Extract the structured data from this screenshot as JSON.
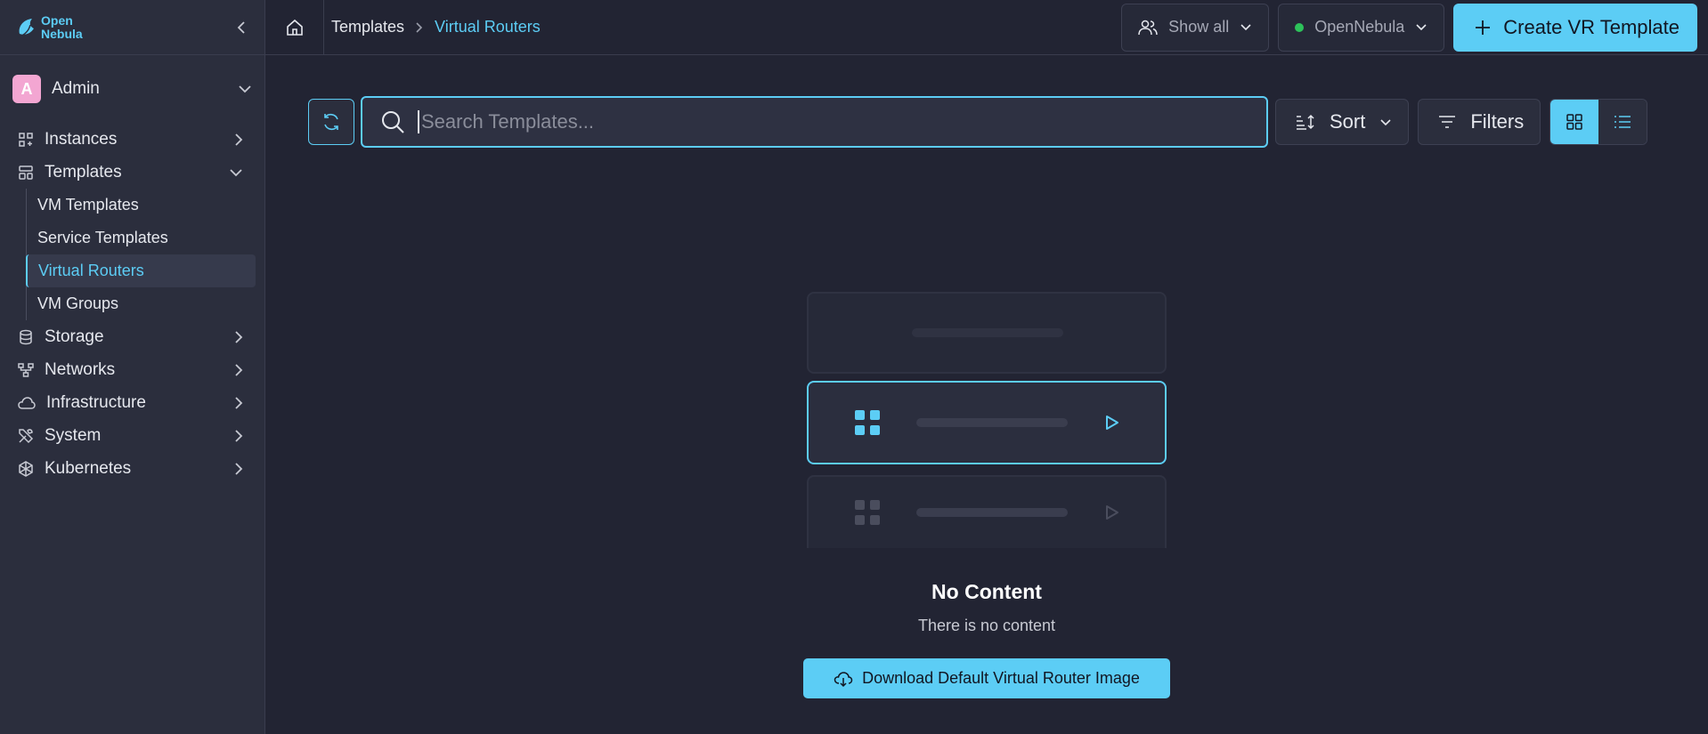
{
  "logo": {
    "line1": "Open",
    "line2": "Nebula"
  },
  "user": {
    "initial": "A",
    "name": "Admin"
  },
  "sidebar": {
    "items": [
      {
        "label": "Instances",
        "icon": "instances-icon"
      },
      {
        "label": "Templates",
        "icon": "templates-icon"
      },
      {
        "label": "Storage",
        "icon": "storage-icon"
      },
      {
        "label": "Networks",
        "icon": "networks-icon"
      },
      {
        "label": "Infrastructure",
        "icon": "cloud-icon"
      },
      {
        "label": "System",
        "icon": "tools-icon"
      },
      {
        "label": "Kubernetes",
        "icon": "kubernetes-icon"
      }
    ],
    "templates_sub": [
      "VM Templates",
      "Service Templates",
      "Virtual Routers",
      "VM Groups"
    ]
  },
  "breadcrumb": {
    "parent": "Templates",
    "current": "Virtual Routers"
  },
  "header": {
    "show_all": "Show all",
    "zone": "OpenNebula",
    "create": "Create VR Template"
  },
  "toolbar": {
    "search_placeholder": "Search Templates...",
    "sort": "Sort",
    "filters": "Filters"
  },
  "empty": {
    "title": "No Content",
    "subtitle": "There is no content",
    "download": "Download Default Virtual Router Image"
  },
  "colors": {
    "accent": "#5ccdf5",
    "background": "#222433",
    "sidebar": "#2b2e3d",
    "status_green": "#2dc25a"
  }
}
